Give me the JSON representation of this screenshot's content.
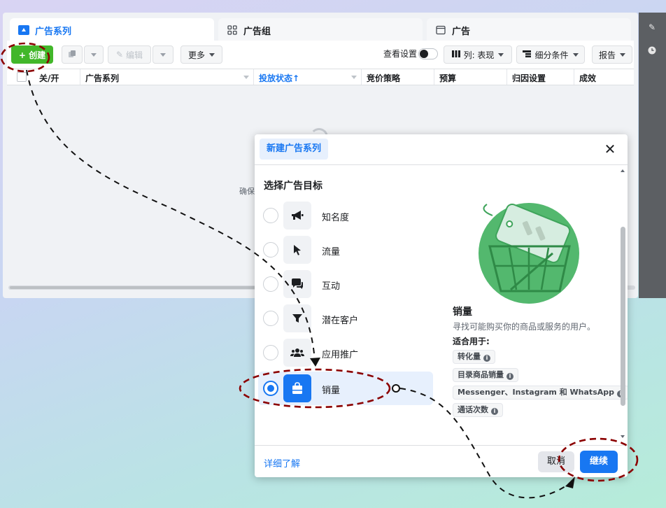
{
  "tabs": [
    {
      "label": "广告系列"
    },
    {
      "label": "广告组"
    },
    {
      "label": "广告"
    }
  ],
  "toolbar": {
    "create": "+ 创建",
    "edit": "编辑",
    "more": "更多",
    "view_settings": "查看设置",
    "columns": "列: 表现",
    "breakdown": "细分条件",
    "reports": "报告"
  },
  "table": {
    "headers": [
      "关/开",
      "广告系列",
      "投放状态↑",
      "竞价策略",
      "预算",
      "归因设置",
      "成效"
    ],
    "hint": "确保"
  },
  "modal": {
    "tab": "新建广告系列",
    "title": "选择广告目标",
    "options": [
      {
        "label": "知名度",
        "icon": "megaphone-icon",
        "selected": false
      },
      {
        "label": "流量",
        "icon": "cursor-icon",
        "selected": false
      },
      {
        "label": "互动",
        "icon": "chat-bubbles-icon",
        "selected": false
      },
      {
        "label": "潜在客户",
        "icon": "funnel-icon",
        "selected": false
      },
      {
        "label": "应用推广",
        "icon": "people-icon",
        "selected": false
      },
      {
        "label": "销量",
        "icon": "shopping-bag-icon",
        "selected": true
      }
    ],
    "detail": {
      "title": "销量",
      "description": "寻找可能购买你的商品或服务的用户。",
      "fit_label": "适合用于:",
      "chips": [
        "转化量",
        "目录商品销量",
        "Messenger、Instagram 和 WhatsApp",
        "通话次数"
      ]
    },
    "learn_more": "详细了解",
    "cancel": "取消",
    "continue": "继续"
  },
  "colors": {
    "accent": "#1877f2",
    "create_green": "#42b72a",
    "annotation": "#8b0000",
    "illustration_green": "#3fa45b"
  }
}
